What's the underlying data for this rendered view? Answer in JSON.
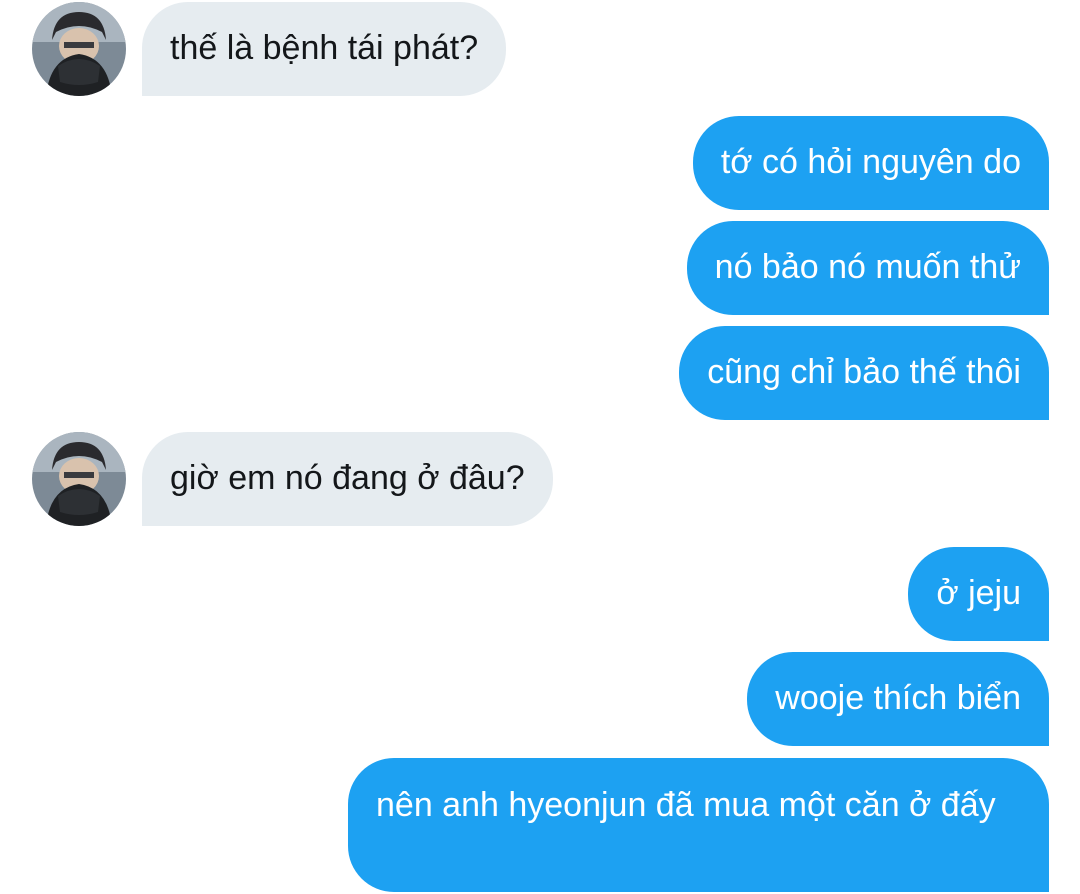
{
  "conversation": {
    "messages": [
      {
        "side": "received",
        "text": "thế là bệnh tái phát?"
      },
      {
        "side": "sent",
        "text": "tớ có hỏi nguyên do"
      },
      {
        "side": "sent",
        "text": "nó bảo nó muốn thử"
      },
      {
        "side": "sent",
        "text": "cũng chỉ bảo thế thôi"
      },
      {
        "side": "received",
        "text": "giờ em nó đang ở đâu?"
      },
      {
        "side": "sent",
        "text": "ở jeju"
      },
      {
        "side": "sent",
        "text": "wooje thích biển"
      },
      {
        "side": "sent",
        "text": "nên anh hyeonjun đã mua một căn ở đấy"
      }
    ]
  },
  "colors": {
    "sent_bubble": "#1da1f2",
    "received_bubble": "#e6ecf0",
    "background": "#ffffff"
  },
  "icons": {
    "avatar": "user-avatar-photo"
  }
}
